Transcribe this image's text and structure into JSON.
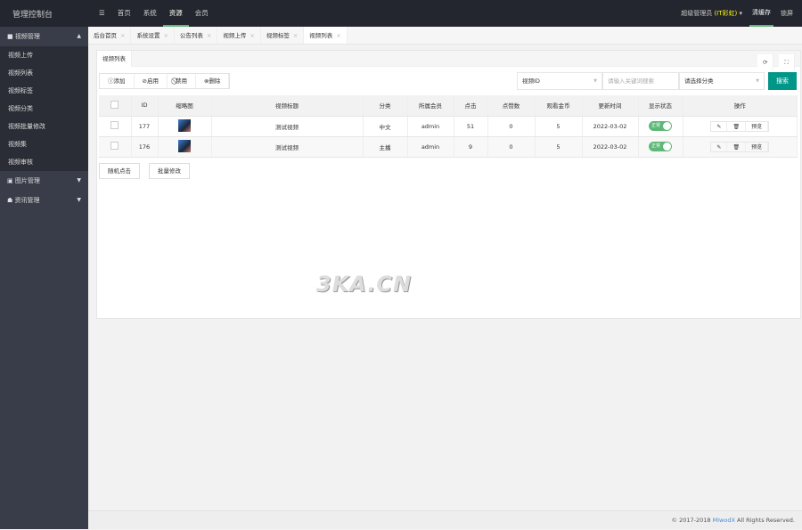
{
  "app_title": "管理控制台",
  "nav": {
    "menu_icon": "☰",
    "items": [
      "首页",
      "系统",
      "资源",
      "会员"
    ],
    "active": 2
  },
  "user": {
    "role": "超级管理员",
    "tag": "(IT彩虹)",
    "clear_cache": "清缓存",
    "lock": "锁屏"
  },
  "sidebar": {
    "groups": [
      {
        "label": "视频管理",
        "icon": "video-icon",
        "expanded": true,
        "items": [
          "视频上传",
          "视频列表",
          "视频标签",
          "视频分类",
          "视频批量修改",
          "视频集",
          "视频审核"
        ]
      },
      {
        "label": "图片管理",
        "icon": "image-icon"
      },
      {
        "label": "资讯管理",
        "icon": "news-icon"
      }
    ]
  },
  "tabs": [
    "后台首页",
    "系统设置",
    "公告列表",
    "视频上传",
    "视频标签",
    "视频列表"
  ],
  "card_tab": "视频列表",
  "toolbar": {
    "add": "添加",
    "enable": "启用",
    "disable": "禁用",
    "delete": "删除"
  },
  "search": {
    "field": "视频ID",
    "placeholder": "请输入关键词搜索",
    "category": "请选择分类",
    "button": "搜索"
  },
  "table": {
    "columns": [
      "ID",
      "缩略图",
      "视频标题",
      "分类",
      "所属会员",
      "点击",
      "点赞数",
      "观看金币",
      "更新时间",
      "显示状态",
      "操作"
    ],
    "rows": [
      {
        "id": "177",
        "title": "测试视频",
        "category": "中文",
        "member": "admin",
        "clicks": "51",
        "likes": "0",
        "coins": "5",
        "updated": "2022-03-02",
        "status": "正常",
        "status_on": true
      },
      {
        "id": "176",
        "title": "测试视频",
        "category": "主播",
        "member": "admin",
        "clicks": "9",
        "likes": "0",
        "coins": "5",
        "updated": "2022-03-02",
        "status": "正常",
        "status_on": true
      }
    ],
    "actions": {
      "edit": "✎",
      "delete": "🗑",
      "preview": "预览"
    }
  },
  "bottom_buttons": {
    "random_click": "随机点击",
    "batch_edit": "批量修改"
  },
  "watermark": "3KA.CN",
  "footer": {
    "prefix": "© 2017-2018 ",
    "brand": "MiwodX",
    "suffix": " All Rights Reserved."
  },
  "colors": {
    "topbar": "#23262e",
    "sidebar": "#393d49",
    "accent": "#009688",
    "switch": "#5fb878"
  }
}
